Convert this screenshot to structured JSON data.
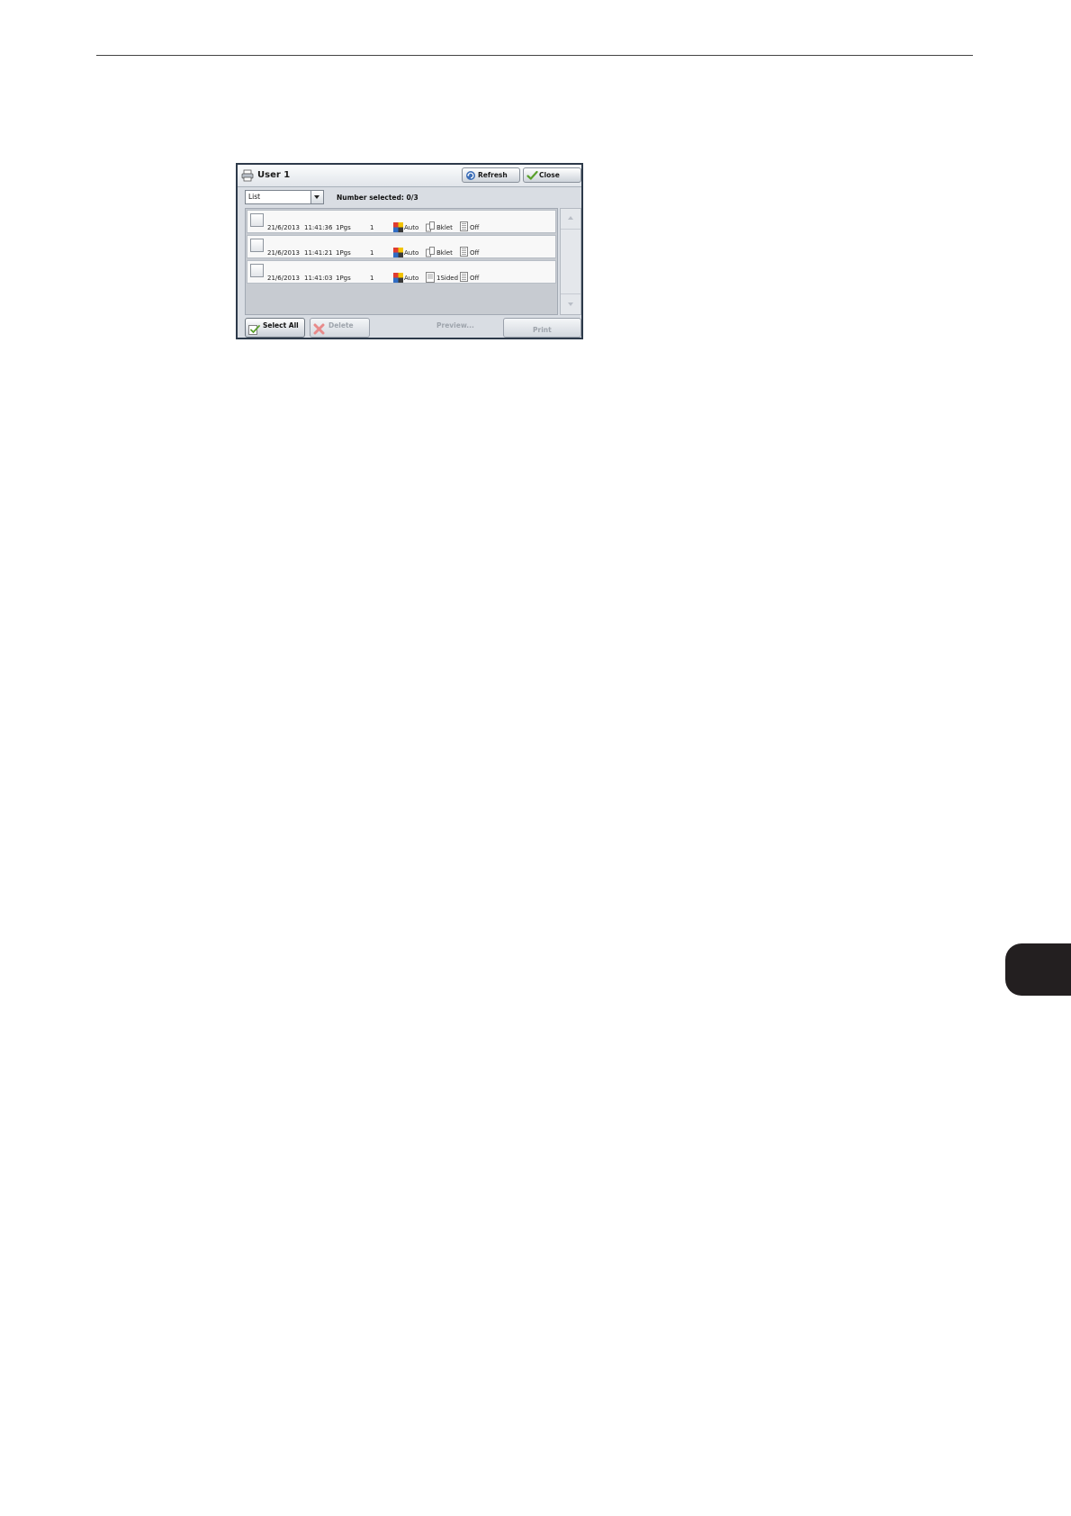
{
  "window": {
    "title": "User 1",
    "refresh_label": "Refresh",
    "close_label": "Close"
  },
  "toolbar": {
    "view_value": "List",
    "number_selected": "Number selected: 0/3"
  },
  "jobs": [
    {
      "date": "21/6/2013",
      "time": "11:41:36",
      "pages": "1Pgs",
      "quantity": "1",
      "color": "Auto",
      "sides": "Bklet",
      "staple": "Off"
    },
    {
      "date": "21/6/2013",
      "time": "11:41:21",
      "pages": "1Pgs",
      "quantity": "1",
      "color": "Auto",
      "sides": "Bklet",
      "staple": "Off"
    },
    {
      "date": "21/6/2013",
      "time": "11:41:03",
      "pages": "1Pgs",
      "quantity": "1",
      "color": "Auto",
      "sides": "1Sided",
      "staple": "Off"
    }
  ],
  "footer": {
    "select_all_label": "Select All",
    "delete_label": "Delete",
    "preview_label": "Preview...",
    "print_label": "Print"
  },
  "icons": {
    "window": "printer-icon",
    "refresh": "refresh-icon",
    "close": "checkmark-icon",
    "color_mode": "color-mode-icon",
    "sides": "booklet-icon",
    "sides_alt": "one-sided-icon",
    "staple": "staple-icon",
    "select_all": "select-all-icon",
    "delete": "delete-x-icon"
  },
  "colors": {
    "panel_border": "#2d3a4a",
    "panel_bg": "#d9dde3",
    "list_bg": "#c7cbd1",
    "disabled_text": "#9ea4ac",
    "delete_icon": "#e88a8a"
  }
}
